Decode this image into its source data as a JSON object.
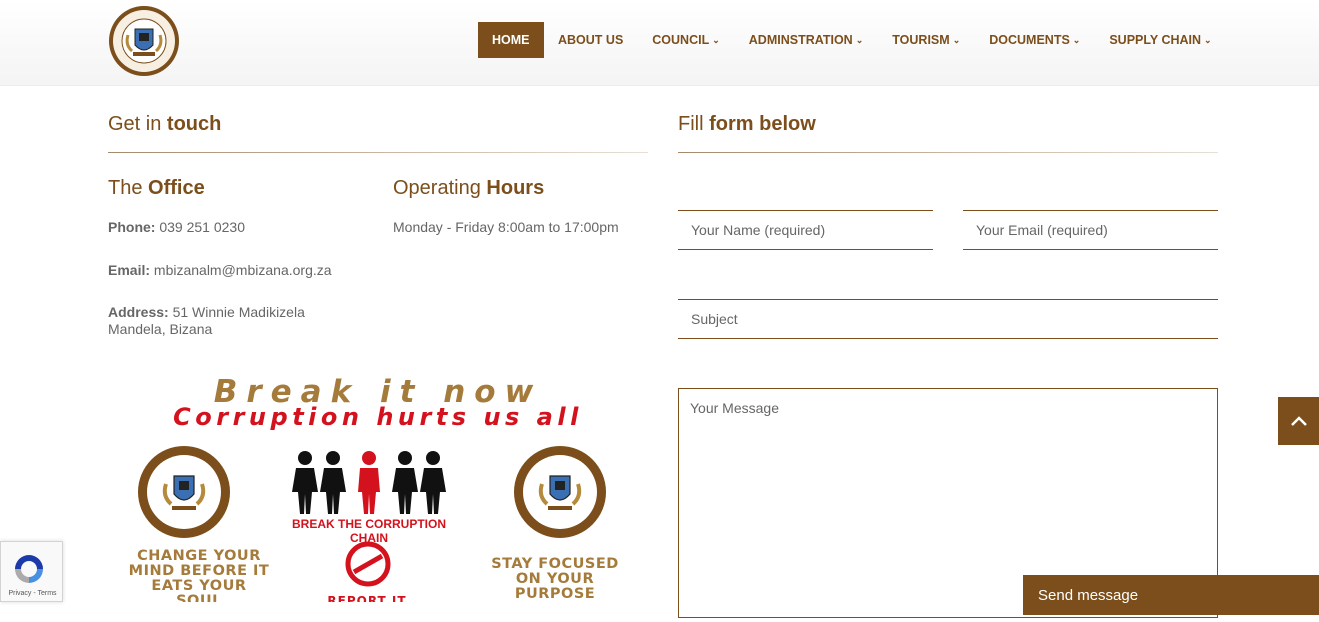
{
  "header": {
    "logo_alt": "Winnie Madikizela-Mandela Local Municipality",
    "nav": [
      {
        "label": "HOME",
        "active": true,
        "dropdown": false
      },
      {
        "label": "ABOUT US",
        "active": false,
        "dropdown": false
      },
      {
        "label": "COUNCIL",
        "active": false,
        "dropdown": true
      },
      {
        "label": "ADMINSTRATION",
        "active": false,
        "dropdown": true
      },
      {
        "label": "TOURISM",
        "active": false,
        "dropdown": true
      },
      {
        "label": "DOCUMENTS",
        "active": false,
        "dropdown": true
      },
      {
        "label": "SUPPLY CHAIN",
        "active": false,
        "dropdown": true
      }
    ]
  },
  "contact": {
    "title_prefix": "Get in",
    "title_bold": "touch",
    "office": {
      "title_prefix": "The",
      "title_bold": "Office",
      "phone_label": "Phone:",
      "phone_value": "039 251 0230",
      "email_label": "Email:",
      "email_value": "mbizanalm@mbizana.org.za",
      "address_label": "Address:",
      "address_line1": "51 Winnie Madikizela",
      "address_line2": "Mandela, Bizana"
    },
    "hours": {
      "title_prefix": "Operating",
      "title_bold": "Hours",
      "text": "Monday - Friday 8:00am to 17:00pm"
    }
  },
  "form": {
    "title_prefix": "Fill",
    "title_bold": "form below",
    "name_placeholder": "Your Name (required)",
    "email_placeholder": "Your Email (required)",
    "subject_placeholder": "Subject",
    "message_placeholder": "Your Message",
    "send_label": "Send message"
  },
  "banner": {
    "slogan1": "Break it now",
    "slogan2": "Corruption hurts us all",
    "chain_caption": "BREAK THE CORRUPTION CHAIN",
    "left_caption": [
      "CHANGE YOUR",
      "MIND BEFORE IT",
      "EATS YOUR",
      "SOUL"
    ],
    "right_caption": [
      "STAY FOCUSED",
      "ON YOUR",
      "PURPOSE"
    ],
    "report_caption": "REPORT IT",
    "badge_text_top": "WINNIE MADIKIZELA-MANDELA",
    "badge_text_bottom": "LOCAL MUNICIPALITY"
  },
  "recaptcha": {
    "privacy": "Privacy",
    "sep": " - ",
    "terms": "Terms"
  },
  "colors": {
    "brand": "#7b4e1b",
    "accent_gold": "#a57b3b",
    "alert_red": "#d4121d"
  }
}
